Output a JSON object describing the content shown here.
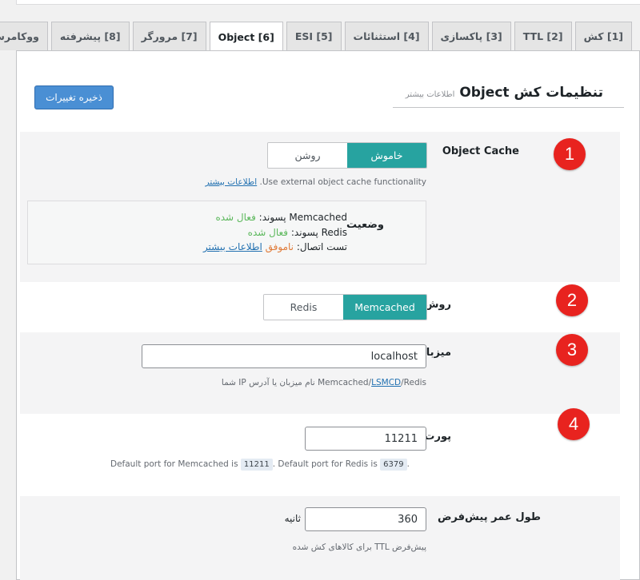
{
  "tabs": [
    {
      "label": "[1] کش",
      "active": false
    },
    {
      "label": "[2] TTL",
      "active": false
    },
    {
      "label": "[3] پاکسازی",
      "active": false
    },
    {
      "label": "[4] استثنائات",
      "active": false
    },
    {
      "label": "[5] ESI",
      "active": false
    },
    {
      "label": "[6] Object",
      "active": true
    },
    {
      "label": "[7] مرورگر",
      "active": false
    },
    {
      "label": "[8] پیشرفته",
      "active": false
    },
    {
      "label": "ووکامرس",
      "active": false
    }
  ],
  "header": {
    "save_label": "ذخیره تغییرات",
    "title": "تنظیمات کش Object",
    "more_info": "اطلاعات بیشتر"
  },
  "object_cache": {
    "label": "Object Cache",
    "off_label": "خاموش",
    "on_label": "روشن",
    "selected": "خاموش",
    "desc": "Use external object cache functionality.",
    "desc_link": "اطلاعات بیشتر",
    "status_label": "وضعیت",
    "memcached_line_prefix": "Memcached پسوند:",
    "memcached_value": "فعال شده",
    "redis_line_prefix": "Redis پسوند:",
    "redis_value": "فعال شده",
    "connection_prefix": "تست اتصال:",
    "connection_value": "ناموفق",
    "connection_link": "اطلاعات بیشتر"
  },
  "method": {
    "label": "روش",
    "option_memcached": "Memcached",
    "option_redis": "Redis",
    "selected": "Memcached"
  },
  "host": {
    "label": "میزبان",
    "value": "localhost",
    "desc_prefix": "Memcached/",
    "desc_link": "LSMCD",
    "desc_suffix": "/Redis نام میزبان یا آدرس IP شما"
  },
  "port": {
    "label": "پورت",
    "value": "11211",
    "desc_part1": "Default port for Memcached is",
    "memcached_port": "11211",
    "desc_part2": ". Default port for Redis is",
    "redis_port": "6379",
    "desc_part3": "."
  },
  "ttl": {
    "label": "طول عمر پیش‌فرض",
    "value": "360",
    "unit": "ثانیه",
    "desc": "پیش‌فرض TTL برای کالاهای کش شده"
  },
  "badges": [
    "1",
    "2",
    "3",
    "4"
  ],
  "colors": {
    "accent": "#27a3a0",
    "button": "#4a8fd4",
    "badge": "#e8231f",
    "link": "#2271b1"
  }
}
